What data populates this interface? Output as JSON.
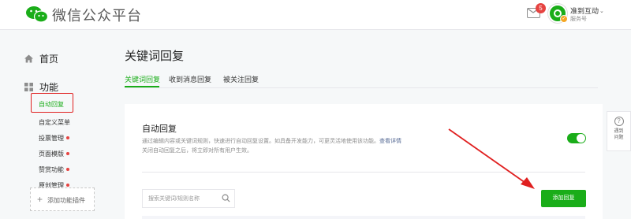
{
  "header": {
    "brand": "微信公众平台",
    "mail_badge": "5",
    "account_name": "准到互动",
    "account_type": "服务号",
    "caret": "⌄"
  },
  "sidebar": {
    "home_label": "首页",
    "function_label": "功能",
    "items": [
      {
        "label": "自动回复",
        "active": true,
        "dot": false
      },
      {
        "label": "自定义菜单",
        "active": false,
        "dot": false
      },
      {
        "label": "投票管理",
        "active": false,
        "dot": true
      },
      {
        "label": "页面模版",
        "active": false,
        "dot": true
      },
      {
        "label": "赞赏功能",
        "active": false,
        "dot": true
      },
      {
        "label": "原创管理",
        "active": false,
        "dot": true
      }
    ],
    "add_plugin_label": "添加功能插件",
    "add_plugin_plus": "+"
  },
  "main": {
    "title": "关键词回复",
    "tabs": [
      {
        "label": "关键词回复",
        "active": true
      },
      {
        "label": "收到消息回复",
        "active": false
      },
      {
        "label": "被关注回复",
        "active": false
      }
    ],
    "card": {
      "title": "自动回复",
      "desc_line1": "通过编辑内容或关键词规则，快速进行自动回复设置。如具备开发能力，可更灵活地使用该功能。",
      "desc_link": "查看详情",
      "desc_line2": "关闭自动回复之后，将立即对所有用户生效。",
      "toggle_on": true,
      "search_placeholder": "搜索关键词/规则名称",
      "add_button": "添加回复"
    }
  },
  "help": {
    "icon": "?",
    "label_line1": "遇到",
    "label_line2": "问题"
  },
  "colors": {
    "accent": "#1aad19",
    "highlight": "#e02020",
    "link": "#576b95",
    "badge": "#e64340"
  }
}
